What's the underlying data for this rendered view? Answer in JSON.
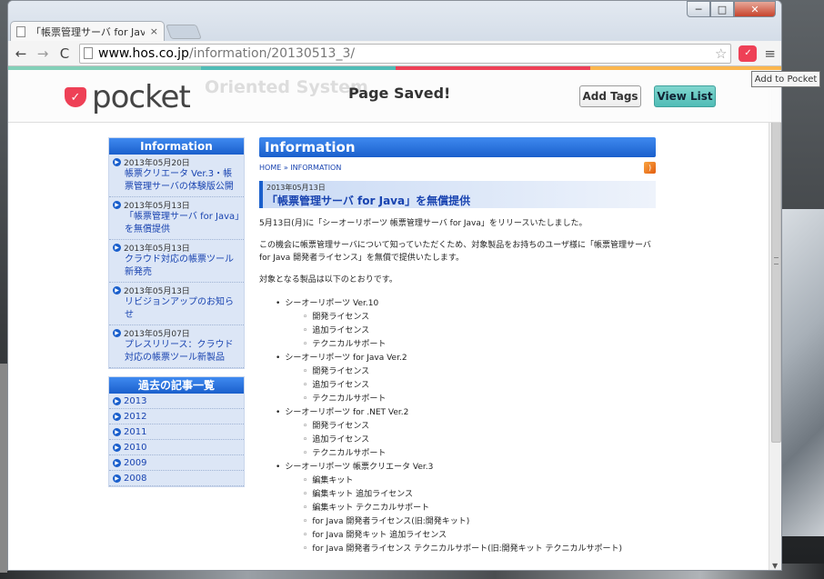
{
  "browser": {
    "tab_title": "「帳票管理サーバ for Jav",
    "tab_close": "×",
    "url_host": "www.hos.co.jp",
    "url_path": "/information/20130513_3/",
    "tooltip": "Add to Pocket",
    "min": "─",
    "max": "□",
    "close": "✕"
  },
  "pocket": {
    "logo_text": "pocket",
    "ghost_text": "Oriented System",
    "saved_message": "Page Saved!",
    "add_tags_label": "Add Tags",
    "view_list_label": "View List",
    "colors": {
      "red": "#ee4056",
      "teal": "#50bcb6",
      "mint": "#83d0b8",
      "orange": "#fcb64e"
    }
  },
  "sidebar": {
    "info_title": "Information",
    "entries": [
      {
        "date": "2013年05月20日",
        "link": "帳票クリエータ Ver.3・帳票管理サーバの体験版公開"
      },
      {
        "date": "2013年05月13日",
        "link": "「帳票管理サーバ for Java」を無償提供"
      },
      {
        "date": "2013年05月13日",
        "link": "クラウド対応の帳票ツール新発売"
      },
      {
        "date": "2013年05月13日",
        "link": "リビジョンアップのお知らせ"
      },
      {
        "date": "2013年05月07日",
        "link": "プレスリリース：クラウド対応の帳票ツール新製品"
      }
    ],
    "archive_title": "過去の記事一覧",
    "archive_years": [
      "2013",
      "2012",
      "2011",
      "2010",
      "2009",
      "2008"
    ]
  },
  "main": {
    "heading": "Information",
    "breadcrumb": "HOME » INFORMATION",
    "article_date": "2013年05月13日",
    "article_title": "「帳票管理サーバ for Java」を無償提供",
    "para1": "5月13日(月)に「シーオーリポーツ 帳票管理サーバ for Java」をリリースいたしました。",
    "para2": "この機会に帳票管理サーバについて知っていただくため、対象製品をお持ちのユーザ様に「帳票管理サーバ for Java 開発者ライセンス」を無償で提供いたします。",
    "para3": "対象となる製品は以下のとおりです。",
    "products": [
      {
        "name": "シーオーリポーツ Ver.10",
        "items": [
          "開発ライセンス",
          "追加ライセンス",
          "テクニカルサポート"
        ]
      },
      {
        "name": "シーオーリポーツ for Java Ver.2",
        "items": [
          "開発ライセンス",
          "追加ライセンス",
          "テクニカルサポート"
        ]
      },
      {
        "name": "シーオーリポーツ for .NET Ver.2",
        "items": [
          "開発ライセンス",
          "追加ライセンス",
          "テクニカルサポート"
        ]
      },
      {
        "name": "シーオーリポーツ 帳票クリエータ Ver.3",
        "items": [
          "編集キット",
          "編集キット 追加ライセンス",
          "編集キット テクニカルサポート",
          "for Java 開発者ライセンス(旧:開発キット)",
          "for Java 開発キット 追加ライセンス",
          "for Java 開発者ライセンス テクニカルサポート(旧:開発キット テクニカルサポート)"
        ]
      }
    ]
  }
}
